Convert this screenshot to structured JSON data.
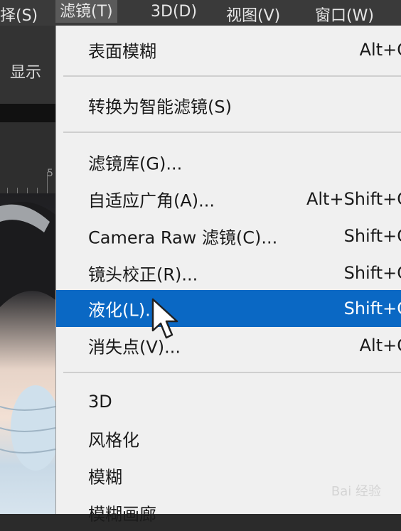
{
  "menubar": {
    "items": [
      "择(S)",
      "滤镜(T)",
      "3D(D)",
      "视图(V)",
      "窗口(W)"
    ],
    "active_index": 1
  },
  "options_bar": {
    "label": "显示"
  },
  "ruler": {
    "label": "5"
  },
  "menu": {
    "items": [
      {
        "label": "表面模糊",
        "shortcut": "Alt+C"
      },
      {
        "label": "转换为智能滤镜(S)",
        "shortcut": ""
      },
      {
        "label": "滤镜库(G)...",
        "shortcut": ""
      },
      {
        "label": "自适应广角(A)...",
        "shortcut": "Alt+Shift+C"
      },
      {
        "label": "Camera Raw 滤镜(C)...",
        "shortcut": "Shift+C"
      },
      {
        "label": "镜头校正(R)...",
        "shortcut": "Shift+C"
      },
      {
        "label": "液化(L)...",
        "shortcut": "Shift+C",
        "highlighted": true
      },
      {
        "label": "消失点(V)...",
        "shortcut": "Alt+C"
      },
      {
        "label": "3D",
        "shortcut": ""
      },
      {
        "label": "风格化",
        "shortcut": ""
      },
      {
        "label": "模糊",
        "shortcut": ""
      },
      {
        "label": "模糊画廊",
        "shortcut": ""
      }
    ]
  },
  "watermark": "Bai 经验",
  "colors": {
    "highlight": "#0a68c4",
    "menu_bg": "#f0f0f0",
    "menubar_bg": "#3a3a3a"
  }
}
